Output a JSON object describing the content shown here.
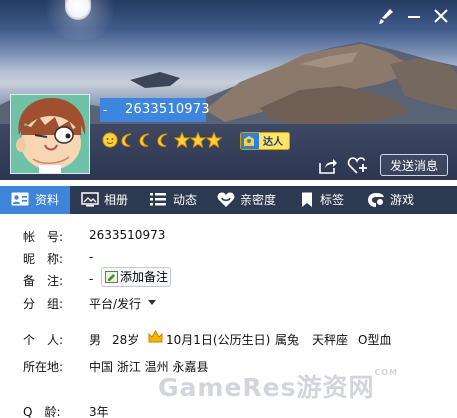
{
  "header": {
    "qq_number": "2633510973",
    "qq_prefix": "-",
    "vip_label": "达人",
    "send_message": "发送消息"
  },
  "tabs": [
    {
      "label": "资料",
      "icon": "profile-card-icon",
      "active": true
    },
    {
      "label": "相册",
      "icon": "album-icon"
    },
    {
      "label": "动态",
      "icon": "feed-list-icon"
    },
    {
      "label": "亲密度",
      "icon": "heart-icon"
    },
    {
      "label": "标签",
      "icon": "bookmark-icon"
    },
    {
      "label": "游戏",
      "icon": "game-icon"
    }
  ],
  "info": {
    "account_label": "帐　号:",
    "account_value": "2633510973",
    "nickname_label": "昵　称:",
    "nickname_value": "-",
    "remark_label": "备　注:",
    "remark_value": "-",
    "add_remark": "添加备注",
    "group_label": "分　组:",
    "group_value": "平台/发行",
    "personal_label": "个　人:",
    "gender": "男",
    "age": "28岁",
    "birthday": "10月1日(公历生日)",
    "zodiac": "属兔",
    "constellation": "天秤座",
    "blood": "O型血",
    "location_label": "所在地:",
    "location_value": "中国 浙江 温州 永嘉县",
    "qage_label": "Q　龄:",
    "qage_value": "3年"
  },
  "watermark": {
    "main": "GameRes游资网",
    "sub": "COM"
  },
  "colors": {
    "tab_bar": "#2d3950",
    "tab_active": "#3e84d8",
    "number_highlight": "#3e86dd"
  }
}
